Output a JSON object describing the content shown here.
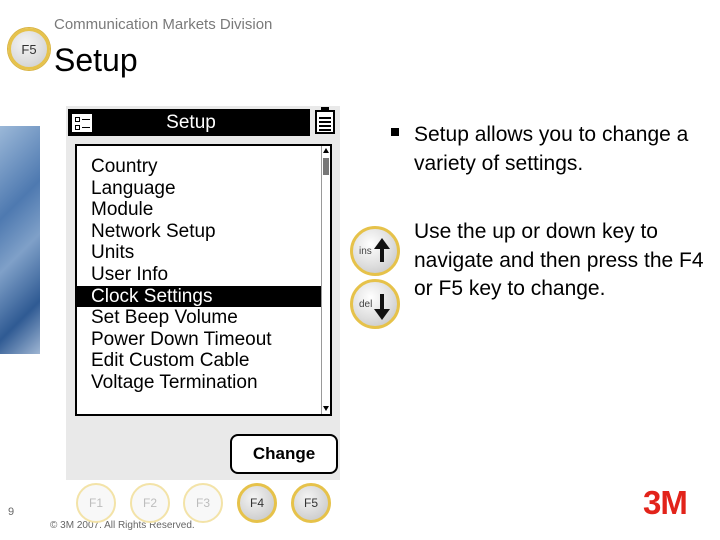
{
  "header": {
    "badge": "F5",
    "division": "Communication Markets Division",
    "title": "Setup"
  },
  "device": {
    "title": "Setup",
    "menu_items": [
      "Country",
      "Language",
      "Module",
      "Network Setup",
      "Units",
      "User Info",
      "Clock Settings",
      "Set Beep Volume",
      "Power Down Timeout",
      "Edit Custom Cable",
      "Voltage Termination"
    ],
    "selected_item": "Clock Settings",
    "change_button": "Change"
  },
  "keys": {
    "up_label": "ins",
    "down_label": "del"
  },
  "description": {
    "bullet_1": "Setup allows you to change a variety of settings.",
    "bullet_2": "Use the up or down key to navigate and then press the F4 or F5 key to change."
  },
  "footer": {
    "page_number": "9",
    "copyright": "© 3M 2007.  All Rights Reserved.",
    "function_keys": [
      "F1",
      "F2",
      "F3",
      "F4",
      "F5"
    ],
    "active_keys": [
      "F4",
      "F5"
    ],
    "logo": "3M"
  },
  "colors": {
    "accent_gold": "#e6c24a",
    "logo_red": "#e2231a",
    "selection_bg": "#000000"
  }
}
